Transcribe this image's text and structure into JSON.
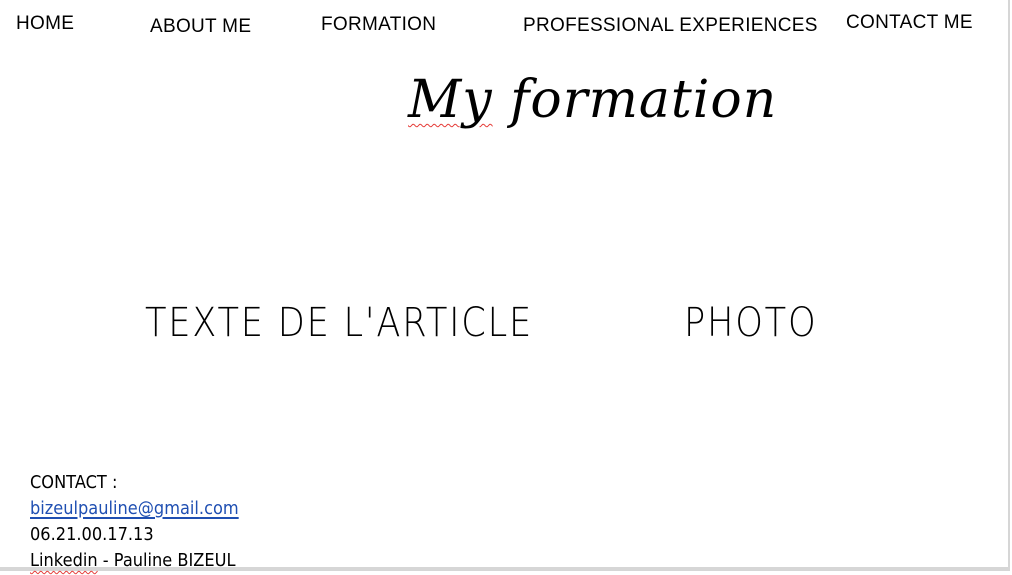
{
  "nav": {
    "home": "HOME",
    "about": "ABOUT ME",
    "formation": "FORMATION",
    "professional": "PROFESSIONAL EXPERIENCES",
    "contact": "CONTACT ME"
  },
  "page": {
    "title_word1": "My",
    "title_word2": " formation"
  },
  "content": {
    "article_text": "TEXTE DE L'ARTICLE",
    "photo_text": "PHOTO"
  },
  "contact": {
    "label": "CONTACT  :",
    "email": "bizeulpauline@gmail.com",
    "phone": "06.21.00.17.13",
    "linkedin_word": "Linkedin",
    "linkedin_rest": " - Pauline BIZEUL"
  },
  "colors": {
    "link": "#1f4fb2",
    "spellcheck": "#e53935"
  }
}
